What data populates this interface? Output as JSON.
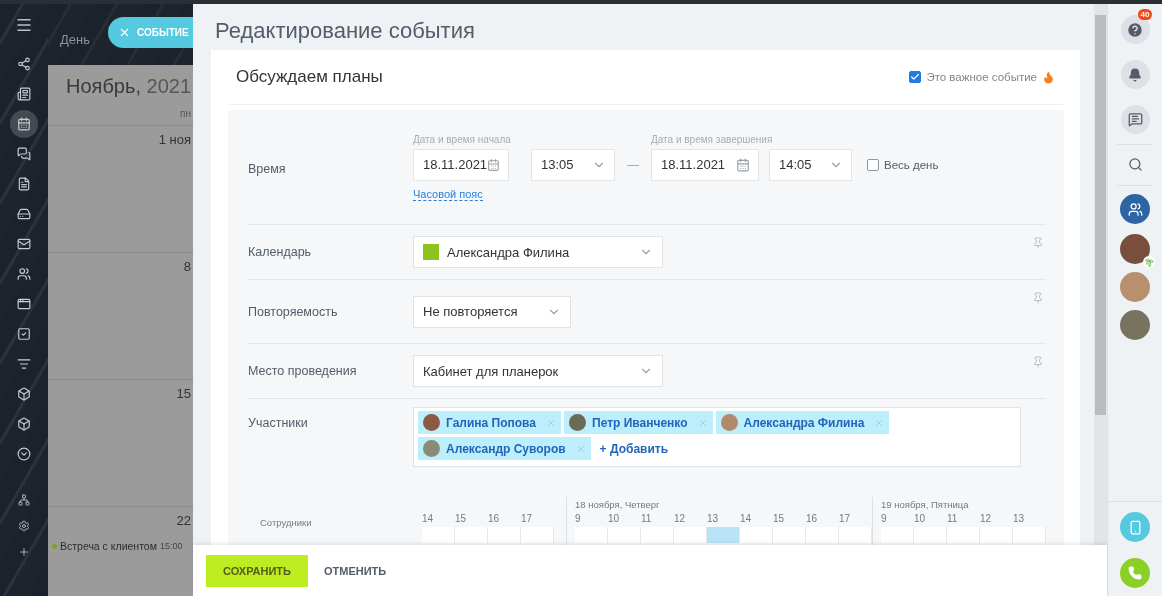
{
  "sidebar": {
    "items": [
      {
        "kind": "share",
        "selected": false
      },
      {
        "kind": "news",
        "selected": false
      },
      {
        "kind": "calendar",
        "selected": true
      },
      {
        "kind": "chat",
        "selected": false
      },
      {
        "kind": "docs",
        "selected": false
      },
      {
        "kind": "drive",
        "selected": false
      },
      {
        "kind": "mail",
        "selected": false
      },
      {
        "kind": "people",
        "selected": false
      },
      {
        "kind": "sites",
        "selected": false
      },
      {
        "kind": "tasks",
        "selected": false
      },
      {
        "kind": "filter",
        "selected": false
      },
      {
        "kind": "box",
        "selected": false
      },
      {
        "kind": "box",
        "selected": false
      },
      {
        "kind": "more",
        "selected": false
      }
    ],
    "bottom_items": [
      {
        "kind": "network"
      },
      {
        "kind": "settings"
      },
      {
        "kind": "add"
      }
    ]
  },
  "calendar": {
    "tabs": [
      {
        "label": "День",
        "selected": false
      }
    ],
    "add_button": "СОБЫТИЕ",
    "month": "Ноябрь,",
    "year": "2021",
    "weekday": "пн",
    "weeks": [
      {
        "day": "1 ноя"
      },
      {
        "day": "8"
      },
      {
        "day": "15"
      },
      {
        "day": "22",
        "events": [
          {
            "title": "Встреча с клиентом",
            "time": "15:00",
            "color": "#7aa51f"
          }
        ]
      }
    ]
  },
  "editor": {
    "title": "Редактирование события",
    "event_name": "Обсуждаем планы",
    "important": {
      "label": "Это важное событие",
      "checked": true
    },
    "rows": [
      {
        "kind": "time",
        "label": "Время",
        "start": {
          "caption": "Дата и время начала",
          "date": "18.11.2021",
          "time": "13:05"
        },
        "end": {
          "caption": "Дата и время завершения",
          "date": "18.11.2021",
          "time": "14:05"
        },
        "all_day": {
          "label": "Весь день",
          "checked": false
        },
        "timezone_link": "Часовой пояс",
        "separator": "—"
      },
      {
        "kind": "calendar",
        "label": "Календарь",
        "value": "Александра Филина",
        "color": "#8dc21f"
      },
      {
        "kind": "repeat",
        "label": "Повторяемость",
        "value": "Не повторяется"
      },
      {
        "kind": "location",
        "label": "Место проведения",
        "value": "Кабинет для планерок"
      },
      {
        "kind": "attendees",
        "label": "Участники",
        "attendees": [
          {
            "name": "Галина Попова"
          },
          {
            "name": "Петр Иванченко"
          },
          {
            "name": "Александра Филина"
          },
          {
            "name": "Александр Суворов"
          }
        ],
        "add_label": "+ Добавить"
      },
      {
        "kind": "planner",
        "label": "Сотрудники",
        "days": [
          {
            "hours": [
              {
                "label": "14",
                "selected": false
              },
              {
                "label": "15",
                "selected": false
              },
              {
                "label": "16",
                "selected": false
              },
              {
                "label": "17",
                "selected": false
              }
            ]
          },
          {
            "title": "18 ноября, Четверг",
            "hours": [
              {
                "label": "9",
                "selected": false
              },
              {
                "label": "10",
                "selected": false
              },
              {
                "label": "11",
                "selected": false
              },
              {
                "label": "12",
                "selected": false
              },
              {
                "label": "13",
                "selected": true
              },
              {
                "label": "14",
                "selected": false
              },
              {
                "label": "15",
                "selected": false
              },
              {
                "label": "16",
                "selected": false
              },
              {
                "label": "17",
                "selected": false
              }
            ]
          },
          {
            "title": "19 ноября, Пятница",
            "hours": [
              {
                "label": "9",
                "selected": false
              },
              {
                "label": "10",
                "selected": false
              },
              {
                "label": "11",
                "selected": false
              },
              {
                "label": "12",
                "selected": false
              },
              {
                "label": "13",
                "selected": false
              }
            ]
          }
        ]
      }
    ],
    "buttons": [
      {
        "label": "СОХРАНИТЬ",
        "kind": "primary"
      },
      {
        "label": "ОТМЕНИТЬ",
        "kind": "link"
      }
    ]
  },
  "right_bar": {
    "help_badge": "40",
    "avatars": [
      {
        "vacation": true
      },
      {
        "vacation": false
      },
      {
        "vacation": false
      }
    ]
  }
}
